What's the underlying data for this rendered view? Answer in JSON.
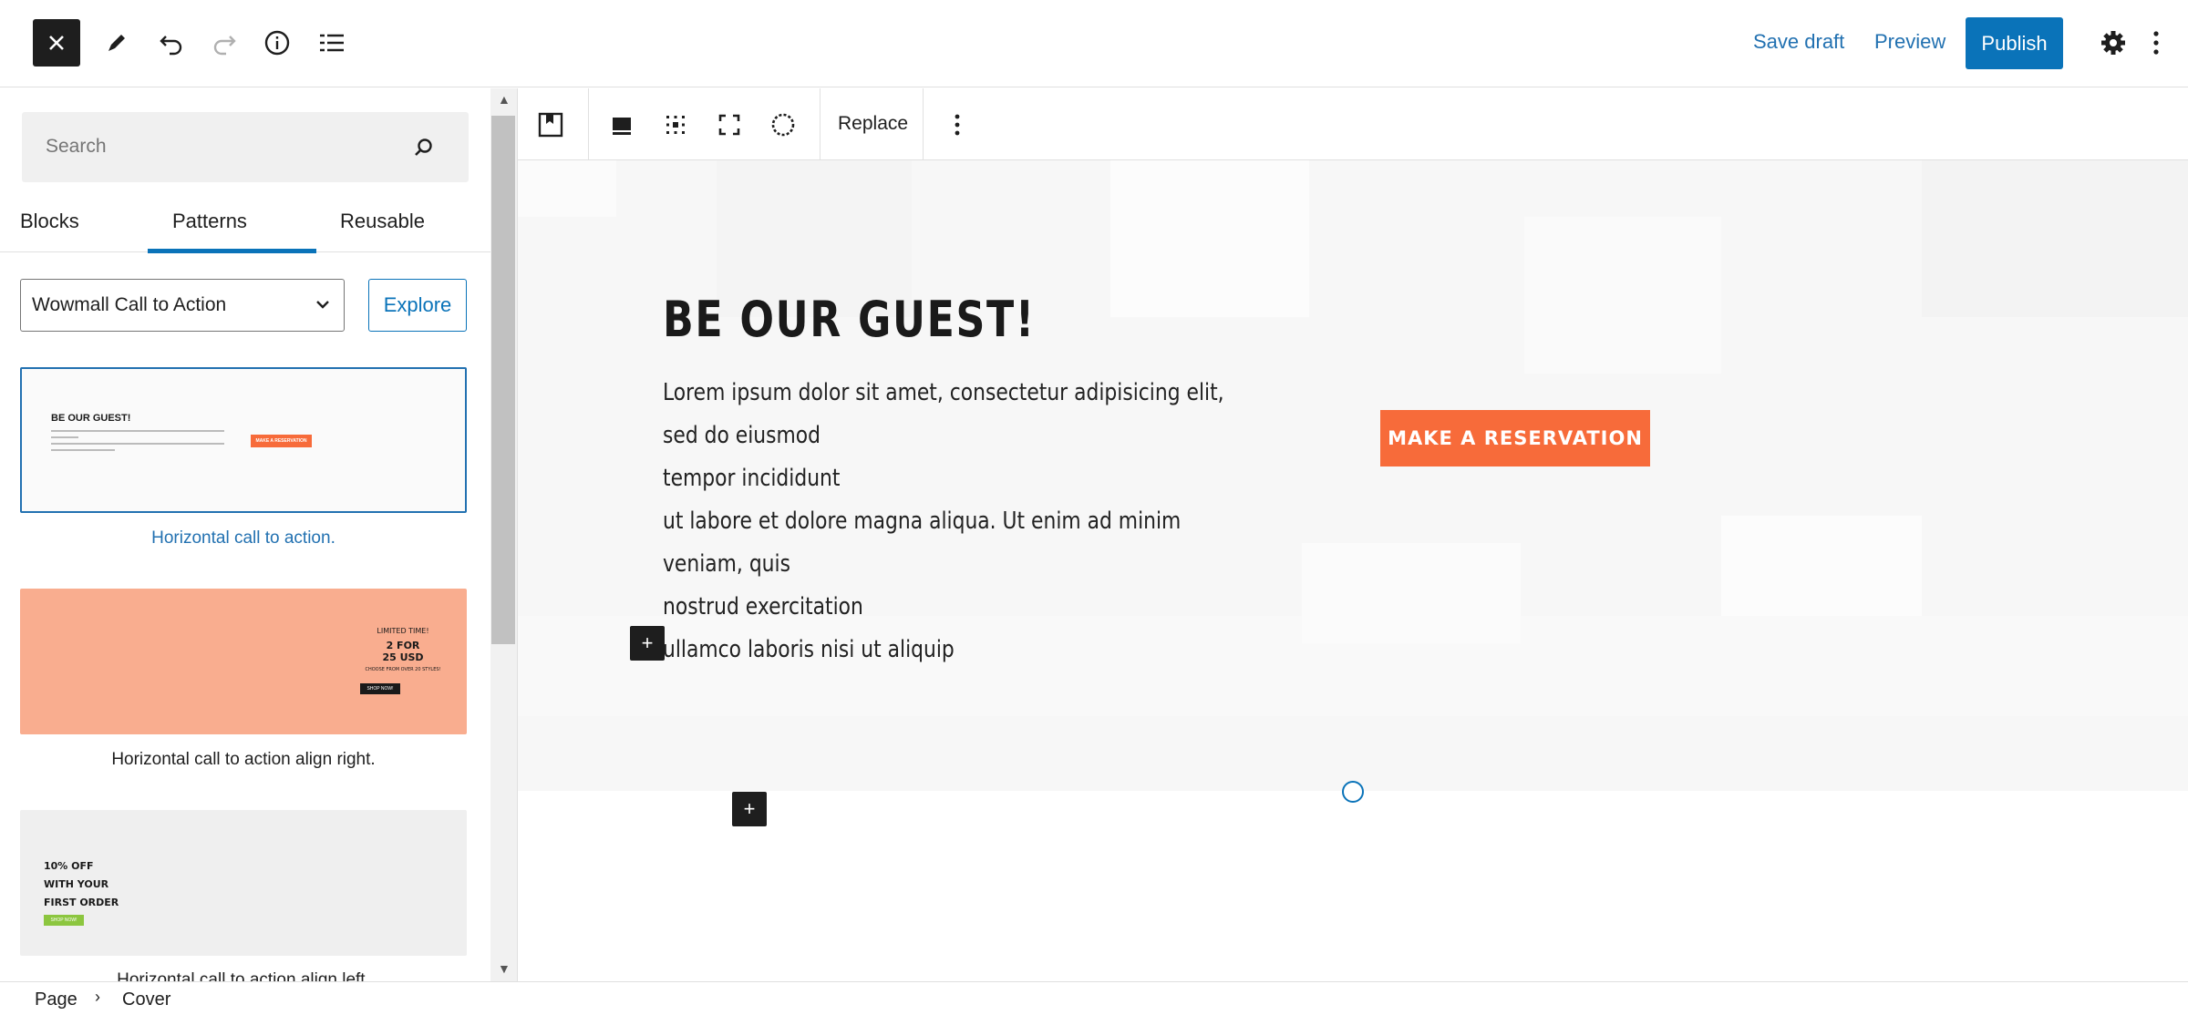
{
  "header": {
    "close_icon": "close-icon",
    "save_draft": "Save draft",
    "preview": "Preview",
    "publish": "Publish"
  },
  "inserter": {
    "search_placeholder": "Search",
    "tabs": [
      "Blocks",
      "Patterns",
      "Reusable"
    ],
    "active_tab": "Patterns",
    "category": "Wowmall Call to Action",
    "explore": "Explore",
    "patterns": [
      {
        "caption": "Horizontal call to action.",
        "selected": true,
        "preview_title": "BE OUR GUEST!",
        "preview_button": "MAKE A RESERVATION"
      },
      {
        "caption": "Horizontal call to action align right.",
        "selected": false,
        "preview_lines": [
          "LIMITED TIME!",
          "2 FOR",
          "25 USD",
          "CHOOSE FROM OVER 20 STYLES!"
        ],
        "preview_button": "SHOP NOW!"
      },
      {
        "caption": "Horizontal call to action align left.",
        "selected": false,
        "preview_lines": [
          "10% OFF",
          "WITH YOUR",
          "FIRST ORDER"
        ],
        "preview_button": "SHOP NOW!"
      }
    ]
  },
  "block_toolbar": {
    "replace": "Replace"
  },
  "cover": {
    "title": "BE OUR GUEST!",
    "paragraph_lines": [
      "Lorem ipsum dolor sit amet, consectetur adipisicing elit, sed do eiusmod",
      "tempor incididunt",
      "ut labore et dolore magna aliqua. Ut enim ad minim veniam, quis",
      "nostrud exercitation",
      "ullamco laboris nisi ut aliquip"
    ],
    "button": "MAKE A RESERVATION",
    "button_color": "#f76b3a"
  },
  "breadcrumb": {
    "items": [
      "Page",
      "Cover"
    ]
  },
  "colors": {
    "accent": "#0a73b9",
    "dark": "#1e1e1e"
  }
}
